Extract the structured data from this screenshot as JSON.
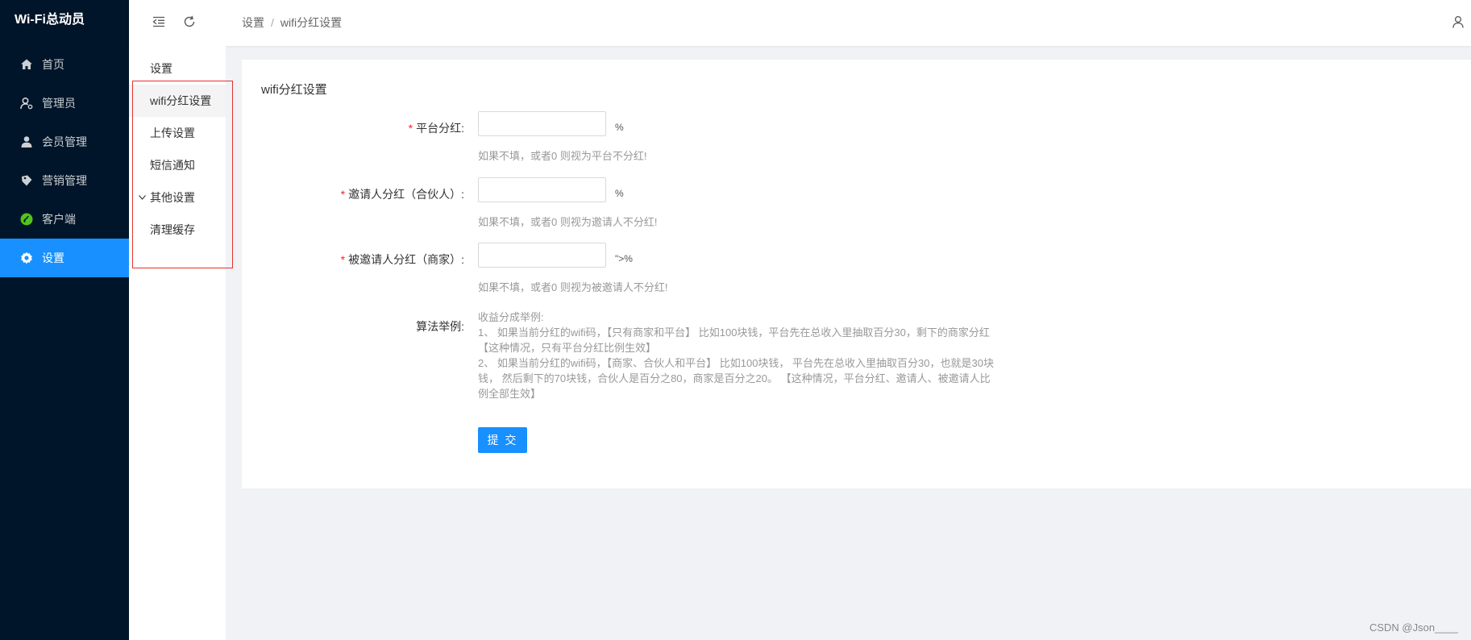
{
  "app": {
    "title": "Wi-Fi总动员"
  },
  "sidebar": {
    "items": [
      {
        "label": "首页",
        "icon": "home-icon"
      },
      {
        "label": "管理员",
        "icon": "admin-user-icon"
      },
      {
        "label": "会员管理",
        "icon": "member-icon"
      },
      {
        "label": "营销管理",
        "icon": "marketing-icon"
      },
      {
        "label": "客户端",
        "icon": "client-icon"
      },
      {
        "label": "设置",
        "icon": "gear-icon",
        "active": true
      }
    ]
  },
  "header": {
    "breadcrumb": [
      "设置",
      "wifi分红设置"
    ],
    "separator": "/"
  },
  "submenu": {
    "title": "设置",
    "items": [
      {
        "label": "wifi分红设置",
        "active": true
      },
      {
        "label": "上传设置"
      },
      {
        "label": "短信通知"
      },
      {
        "label": "其他设置",
        "expandable": true
      },
      {
        "label": "清理缓存"
      }
    ]
  },
  "form": {
    "title": "wifi分红设置",
    "required_mark": "*",
    "fields": [
      {
        "label": "平台分红:",
        "value": "",
        "unit": "%",
        "hint": "如果不填，或者0 则视为平台不分红!"
      },
      {
        "label": "邀请人分红（合伙人）:",
        "value": "",
        "unit": "%",
        "hint": "如果不填，或者0 则视为邀请人不分红!"
      },
      {
        "label": "被邀请人分红（商家）:",
        "value": "",
        "unit": "\">%",
        "hint": "如果不填，或者0 则视为被邀请人不分红!"
      }
    ],
    "algorithm": {
      "label": "算法举例:",
      "lines": [
        "收益分成举例:",
        "1、 如果当前分红的wifi码，【只有商家和平台】 比如100块钱，平台先在总收入里抽取百分30，剩下的商家分红【这种情况，只有平台分红比例生效】",
        "2、 如果当前分红的wifi码，【商家、合伙人和平台】 比如100块钱， 平台先在总收入里抽取百分30，也就是30块钱， 然后剩下的70块钱，合伙人是百分之80，商家是百分之20。 【这种情况，平台分红、邀请人、被邀请人比例全部生效】"
      ]
    },
    "submit_label": "提 交"
  },
  "watermark": "CSDN @Json____",
  "colors": {
    "sidebar_bg": "#001529",
    "accent": "#1890ff",
    "required": "#f5222d",
    "highlight_box": "#e3322e"
  }
}
